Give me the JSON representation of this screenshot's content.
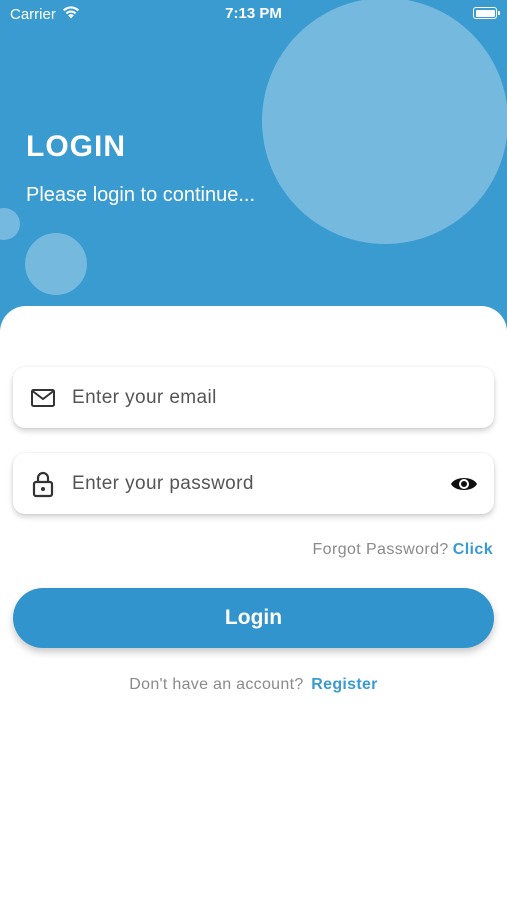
{
  "status_bar": {
    "carrier": "Carrier",
    "time": "7:13 PM"
  },
  "header": {
    "title": "LOGIN",
    "subtitle": "Please login to continue..."
  },
  "form": {
    "email": {
      "value": "",
      "placeholder": "Enter your email",
      "icon": "mail-icon"
    },
    "password": {
      "value": "",
      "placeholder": "Enter your password",
      "icon": "lock-icon",
      "toggle_icon": "eye-icon"
    },
    "forgot_text": "Forgot Password?",
    "forgot_link": "Click",
    "submit_label": "Login",
    "register_text": "Don't have an account?",
    "register_link": "Register"
  },
  "colors": {
    "primary": "#3a9bd0",
    "button": "#3194cc",
    "muted_text": "#8a8a8a",
    "background": "#ffffff"
  }
}
